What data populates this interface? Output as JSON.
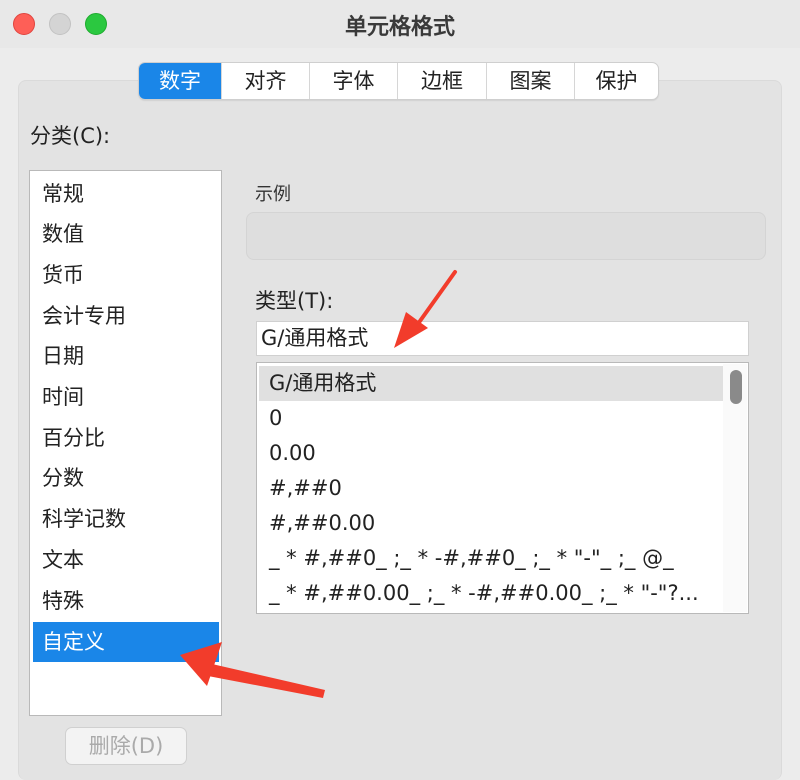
{
  "window": {
    "title": "单元格格式",
    "controls": [
      "close-button",
      "minimize-button",
      "zoom-button"
    ]
  },
  "tabs": [
    {
      "label": "数字",
      "active": true
    },
    {
      "label": "对齐",
      "active": false
    },
    {
      "label": "字体",
      "active": false
    },
    {
      "label": "边框",
      "active": false
    },
    {
      "label": "图案",
      "active": false
    },
    {
      "label": "保护",
      "active": false
    }
  ],
  "category": {
    "label": "分类(C):",
    "items": [
      "常规",
      "数值",
      "货币",
      "会计专用",
      "日期",
      "时间",
      "百分比",
      "分数",
      "科学记数",
      "文本",
      "特殊",
      "自定义"
    ],
    "selected": "自定义"
  },
  "sample": {
    "label": "示例",
    "value": ""
  },
  "type": {
    "label": "类型(T):",
    "value": "G/通用格式"
  },
  "formats": {
    "items": [
      "G/通用格式",
      "0",
      "0.00",
      "#,##0",
      "#,##0.00",
      "_ * #,##0_ ;_ * -#,##0_ ;_ * \"-\"_ ;_ @_",
      "_ * #,##0.00_ ;_ * -#,##0.00_ ;_ * \"-\"?..."
    ],
    "selected": "G/通用格式"
  },
  "buttons": {
    "delete": "删除(D)"
  },
  "colors": {
    "accent": "#1a86e8",
    "annotation_arrow": "#f23c2b"
  },
  "annotations": {
    "arrows": [
      "arrow-to-type-input",
      "arrow-to-custom-category"
    ]
  }
}
